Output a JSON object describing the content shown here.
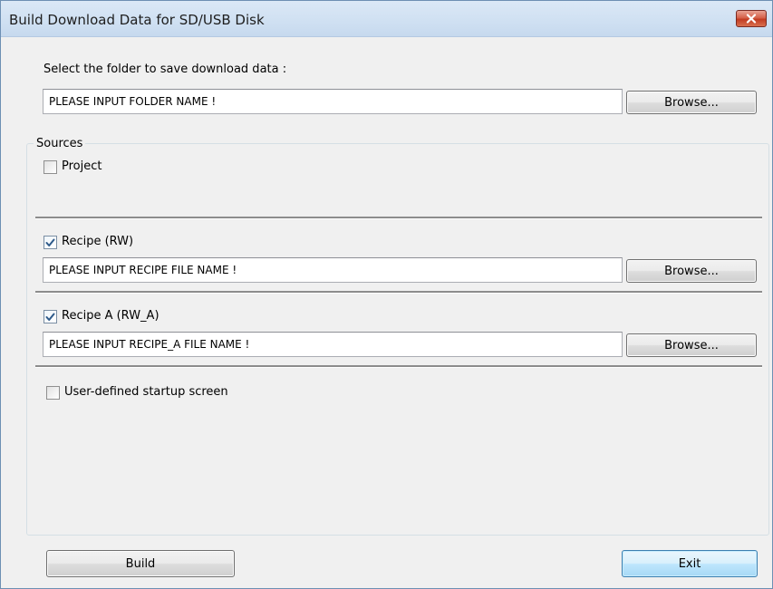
{
  "window": {
    "title": "Build Download Data for SD/USB Disk"
  },
  "folder": {
    "label": "Select the folder to save download data :",
    "value": "PLEASE INPUT FOLDER NAME !",
    "browse_label": "Browse..."
  },
  "sources": {
    "legend": "Sources",
    "project": {
      "label": "Project",
      "checked": false
    },
    "recipe": {
      "label": "Recipe (RW)",
      "checked": true,
      "value": "PLEASE INPUT RECIPE FILE NAME !",
      "browse_label": "Browse..."
    },
    "recipe_a": {
      "label": "Recipe A (RW_A)",
      "checked": true,
      "value": "PLEASE INPUT RECIPE_A FILE NAME !",
      "browse_label": "Browse..."
    },
    "startup": {
      "label": "User-defined startup screen",
      "checked": false
    }
  },
  "footer": {
    "build_label": "Build",
    "exit_label": "Exit"
  },
  "icons": {
    "close": "close-icon",
    "check": "checkmark-icon"
  },
  "colors": {
    "close_button": "#c9452c",
    "check_mark": "#2e5a8a"
  }
}
